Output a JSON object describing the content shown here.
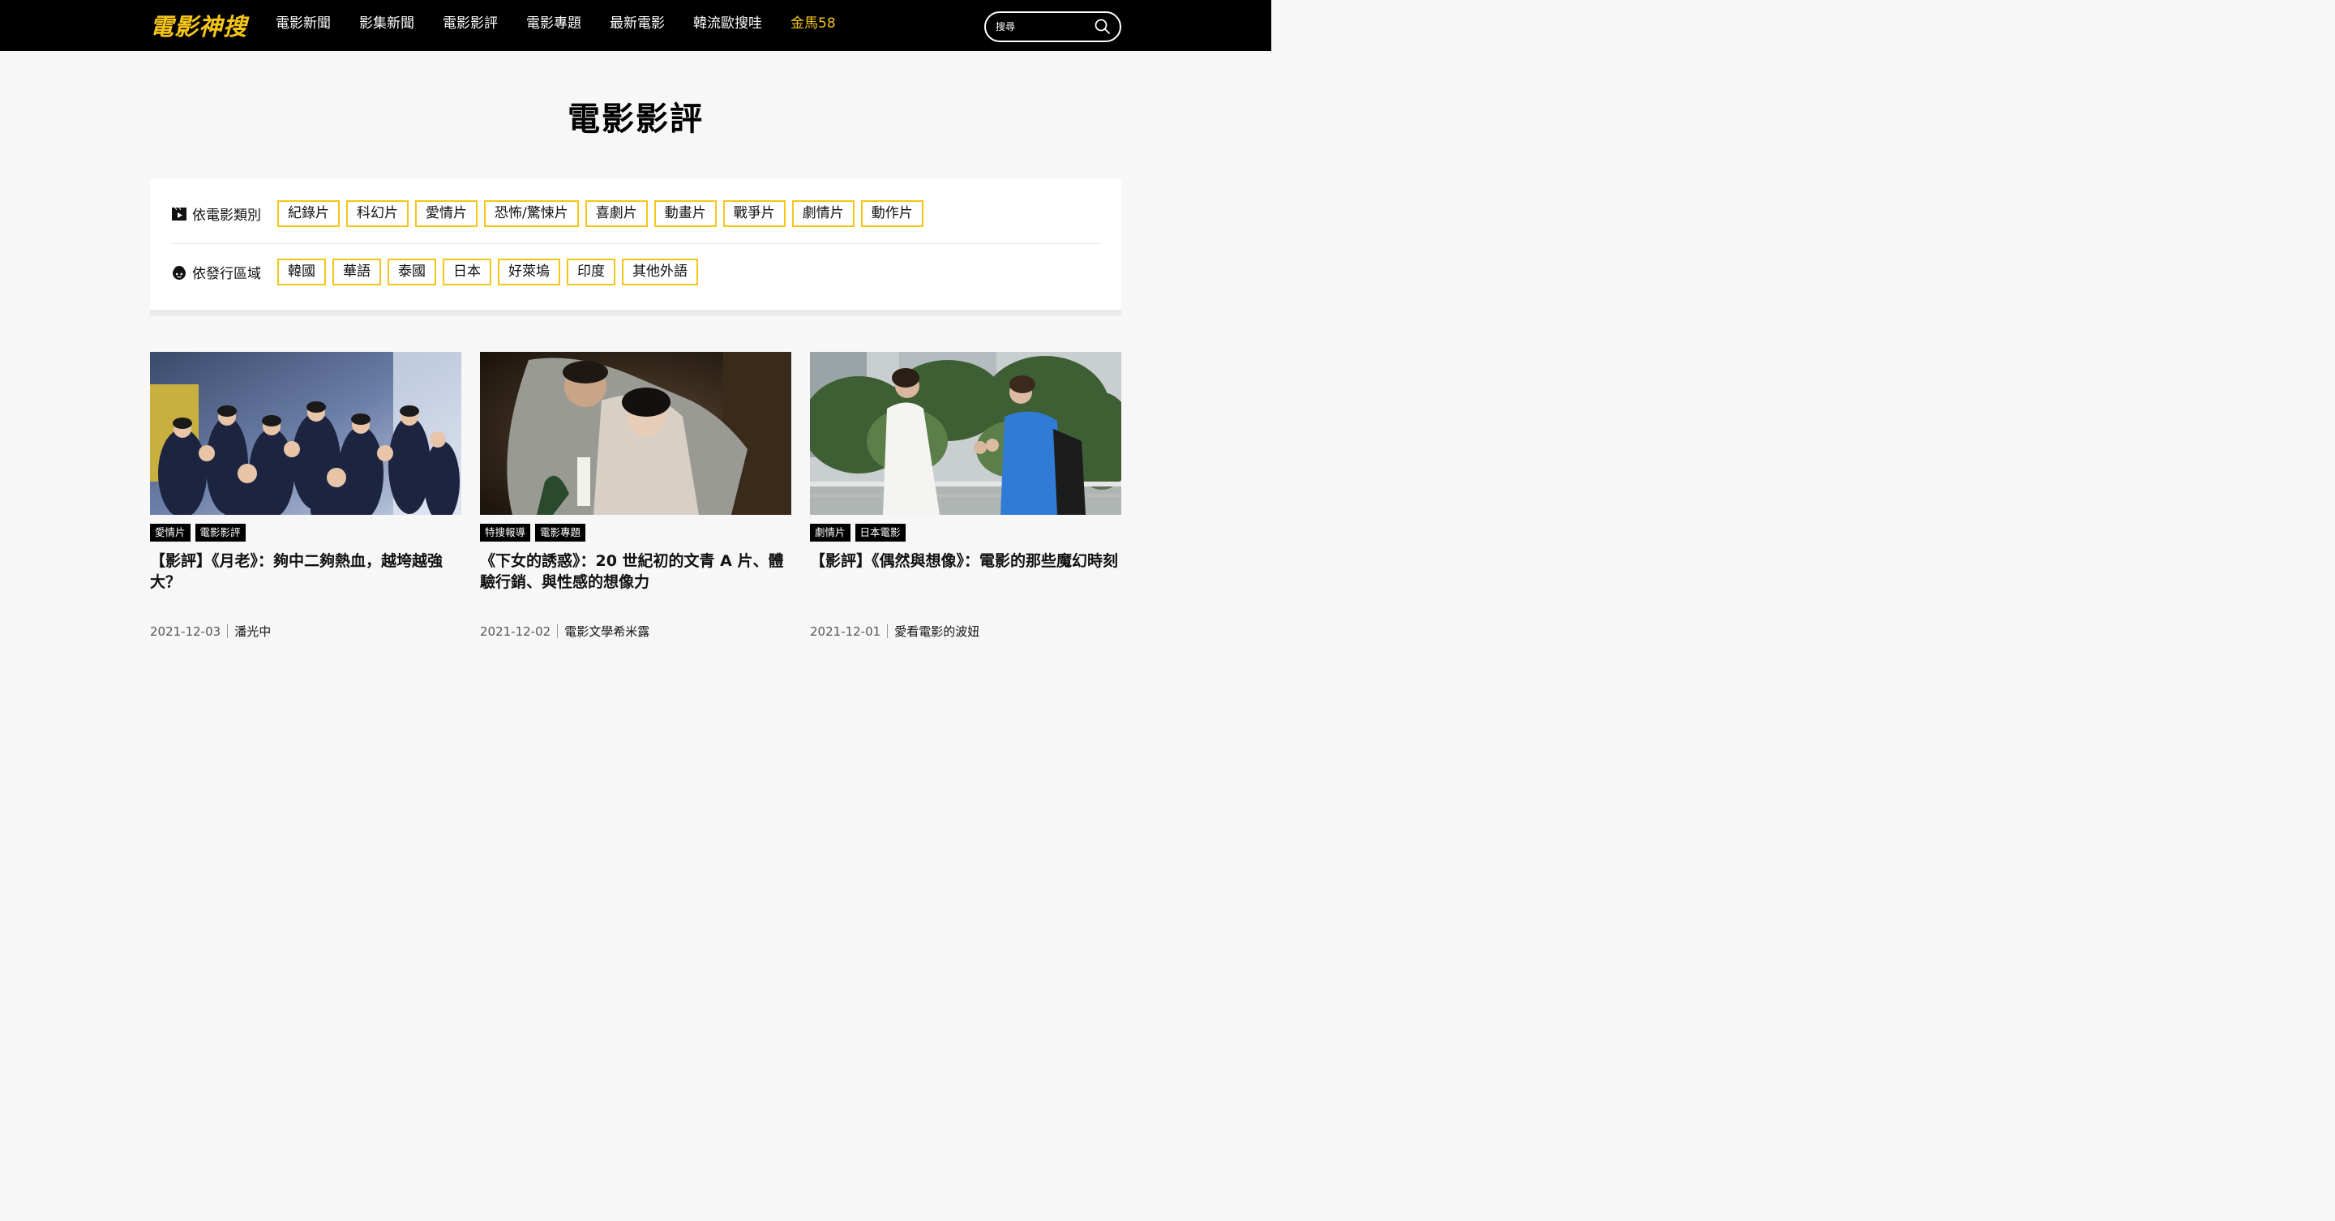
{
  "brand": {
    "logo_text": "電影神搜",
    "accent_color": "#f5c518"
  },
  "nav": {
    "items": [
      {
        "label": "電影新聞"
      },
      {
        "label": "影集新聞"
      },
      {
        "label": "電影影評"
      },
      {
        "label": "電影專題"
      },
      {
        "label": "最新電影"
      },
      {
        "label": "韓流歐搜哇"
      },
      {
        "label": "金馬58",
        "highlight": true
      }
    ]
  },
  "search": {
    "placeholder": "搜尋",
    "icon": "search-icon"
  },
  "page": {
    "title": "電影影評"
  },
  "filters": {
    "genre": {
      "label": "依電影類別",
      "icon": "film-play-icon",
      "tags": [
        "紀錄片",
        "科幻片",
        "愛情片",
        "恐怖/驚悚片",
        "喜劇片",
        "動畫片",
        "戰爭片",
        "劇情片",
        "動作片"
      ]
    },
    "region": {
      "label": "依發行區域",
      "icon": "face-icon",
      "tags": [
        "韓國",
        "華語",
        "泰國",
        "日本",
        "好萊塢",
        "印度",
        "其他外語"
      ]
    }
  },
  "articles": [
    {
      "categories": [
        "愛情片",
        "電影影評"
      ],
      "title": "【影評】《月老》：夠中二夠熱血，越垮越強大？",
      "date": "2021-12-03",
      "author": "潘光中"
    },
    {
      "categories": [
        "特搜報導",
        "電影專題"
      ],
      "title": "《下女的誘惑》：20 世紀初的文青 A 片、體驗行銷、與性感的想像力",
      "date": "2021-12-02",
      "author": "電影文學希米露"
    },
    {
      "categories": [
        "劇情片",
        "日本電影"
      ],
      "title": "【影評】《偶然與想像》：電影的那些魔幻時刻",
      "date": "2021-12-01",
      "author": "愛看電影的波妞"
    }
  ]
}
